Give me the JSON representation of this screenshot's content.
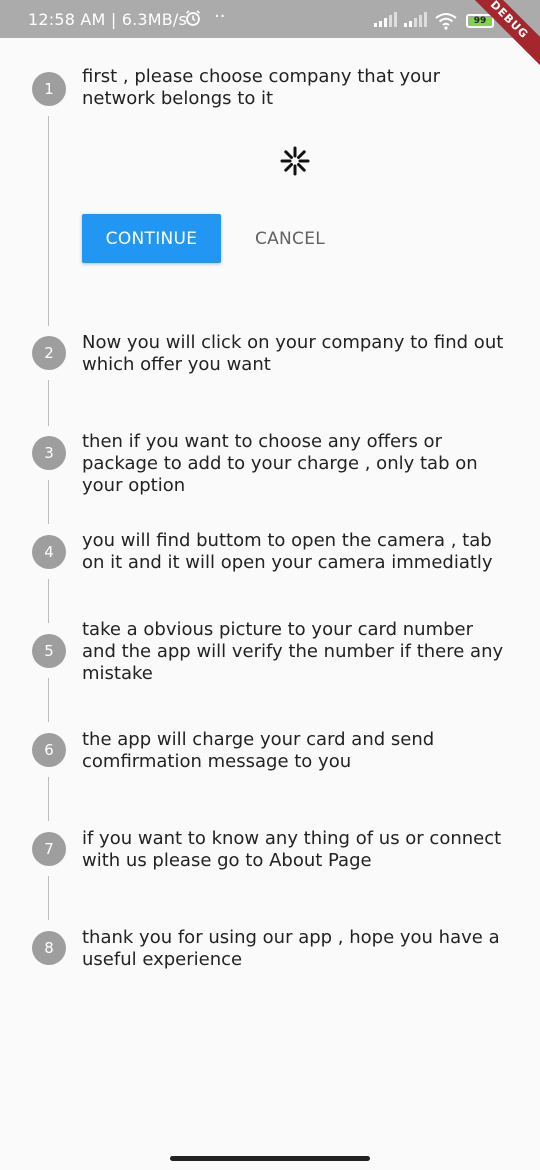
{
  "status_bar": {
    "time": "12:58 AM | 6.3MB/s",
    "dots": "··",
    "battery": "99",
    "debug_banner": "DEBUG"
  },
  "stepper": {
    "continue_label": "CONTINUE",
    "cancel_label": "CANCEL",
    "steps": [
      {
        "number": "1",
        "title": "first , please choose company that your network belongs to it"
      },
      {
        "number": "2",
        "title": "Now you will click on your company to find out which offer you want"
      },
      {
        "number": "3",
        "title": "then if you want to choose any offers or package to add to your charge , only tab on your option"
      },
      {
        "number": "4",
        "title": "you will find buttom to open the camera , tab on it and it will open your camera immediatly"
      },
      {
        "number": "5",
        "title": "take a obvious picture to your card number and the app will verify the number if there any mistake"
      },
      {
        "number": "6",
        "title": "the app will charge your card and send comfirmation message to you"
      },
      {
        "number": "7",
        "title": "if you want to know any thing of us or connect with us please go to About Page"
      },
      {
        "number": "8",
        "title": "thank you for using our app , hope you have a useful experience"
      }
    ]
  },
  "colors": {
    "accent": "#2196f3",
    "step_circle": "#9e9e9e",
    "status_bar": "#ababab",
    "debug_ribbon": "#a5272e"
  }
}
